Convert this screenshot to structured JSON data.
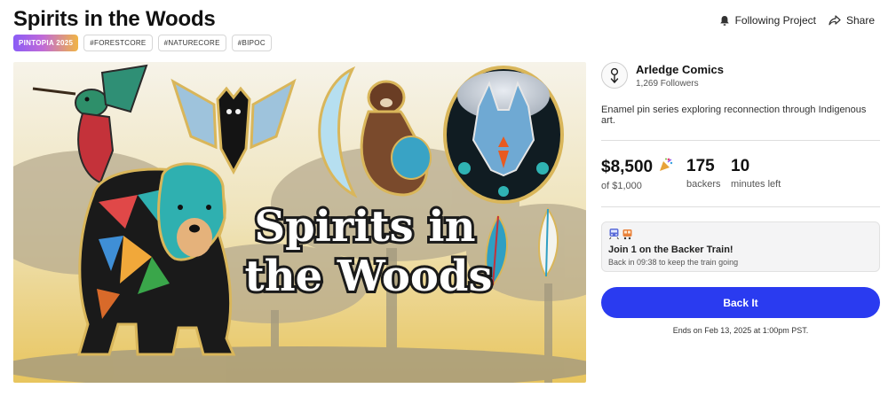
{
  "project": {
    "title": "Spirits in the Woods",
    "tags": [
      "PINTOPIA 2025",
      "#FORESTCORE",
      "#NATURECORE",
      "#BIPOC"
    ]
  },
  "header_actions": {
    "following_label": "Following Project",
    "share_label": "Share"
  },
  "hero": {
    "title_line1": "Spirits in",
    "title_line2": "the Woods"
  },
  "creator": {
    "name": "Arledge Comics",
    "followers": "1,269 Followers"
  },
  "description": "Enamel pin series exploring reconnection through Indigenous art.",
  "stats": {
    "pledged": "$8,500",
    "goal": "of $1,000",
    "backers_count": "175",
    "backers_label": "backers",
    "time_count": "10",
    "time_label": "minutes left"
  },
  "backer_train": {
    "title": "Join 1 on the Backer Train!",
    "subtitle": "Back in 09:38 to keep the train going"
  },
  "cta": {
    "back_label": "Back It",
    "ends_text": "Ends on Feb 13, 2025 at 1:00pm PST."
  },
  "colors": {
    "accent": "#2a3bf0",
    "badge_gradient": [
      "#8a5cf6",
      "#c06ad8",
      "#f0b545"
    ]
  },
  "icons": {
    "follow": "bell-icon",
    "share": "share-icon",
    "celebrate": "party-popper-icon",
    "train": "train-icon"
  }
}
